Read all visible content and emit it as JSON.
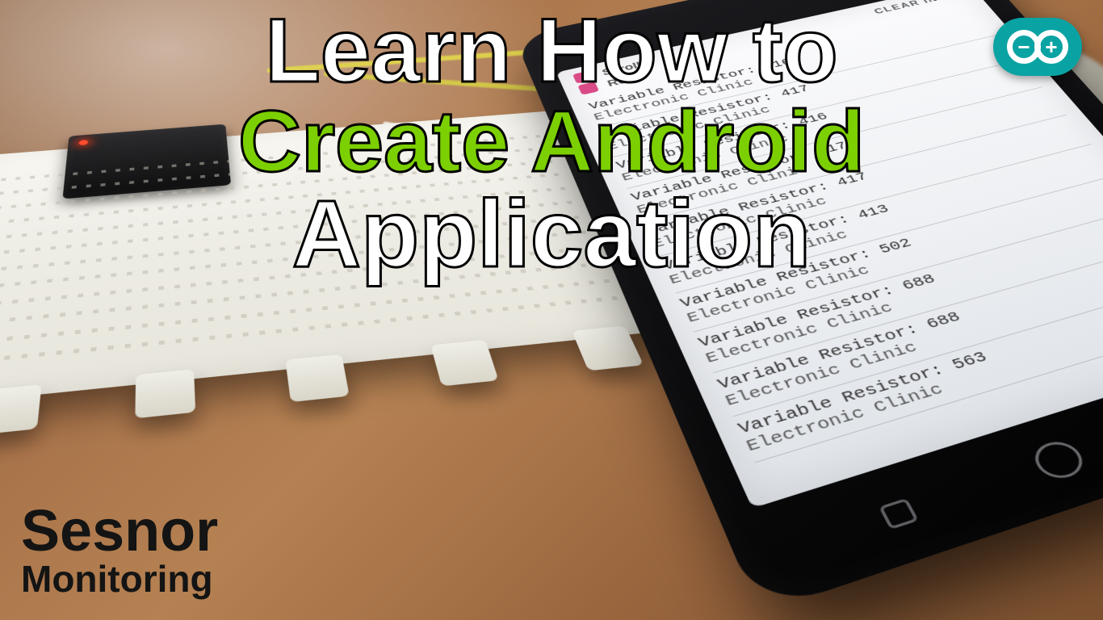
{
  "headline": {
    "line1": "Learn How to",
    "line2": "Create Android",
    "line3": "Application"
  },
  "corner": {
    "line1": "Sesnor",
    "line2": "Monitoring"
  },
  "arduino": {
    "minus": "−",
    "plus": "+"
  },
  "phone": {
    "top": {
      "scroll": "Scroll",
      "read": "Read",
      "clear": "CLEAR INPUT"
    },
    "label_fmt": "Variable Resistor:",
    "sub": "Electronic Clinic",
    "values": [
      "416",
      "417",
      "416",
      "417",
      "417",
      "413",
      "502",
      "688",
      "688",
      "563"
    ]
  }
}
